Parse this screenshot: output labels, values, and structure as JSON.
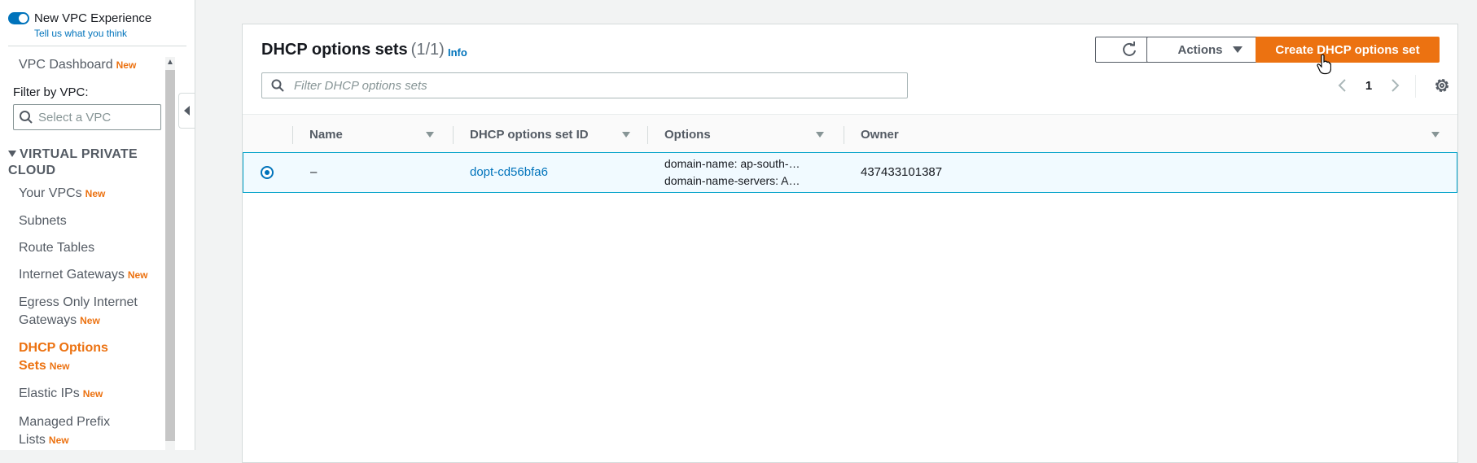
{
  "sidebar": {
    "toggle_label": "New VPC Experience",
    "feedback_link": "Tell us what you think",
    "dashboard_label": "VPC Dashboard",
    "new_badge": "New",
    "filter_label": "Filter by VPC:",
    "vpc_select_placeholder": "Select a VPC",
    "section_title": "VIRTUAL PRIVATE CLOUD",
    "items": [
      {
        "label": "Your VPCs",
        "badge": "New"
      },
      {
        "label": "Subnets",
        "badge": ""
      },
      {
        "label": "Route Tables",
        "badge": ""
      },
      {
        "label": "Internet Gateways",
        "badge": "New"
      },
      {
        "label": "Egress Only Internet Gateways",
        "badge": "New"
      },
      {
        "label": "DHCP Options Sets",
        "badge": "New"
      },
      {
        "label": "Elastic IPs",
        "badge": "New"
      },
      {
        "label": "Managed Prefix Lists",
        "badge": "New"
      }
    ]
  },
  "panel": {
    "title": "DHCP options sets",
    "count": "(1/1)",
    "info_link": "Info",
    "refresh_icon": "refresh-icon",
    "actions_label": "Actions",
    "create_label": "Create DHCP options set",
    "filter_placeholder": "Filter DHCP options sets",
    "page_number": "1"
  },
  "table": {
    "columns": [
      "Name",
      "DHCP options set ID",
      "Options",
      "Owner"
    ],
    "rows": [
      {
        "selected": true,
        "name": "–",
        "id": "dopt-cd56bfa6",
        "options_line1": "domain-name: ap-south-…",
        "options_line2": "domain-name-servers: A…",
        "owner": "437433101387"
      }
    ]
  },
  "colors": {
    "accent": "#ec7211",
    "link": "#0073bb",
    "selected_row_bg": "#f1faff",
    "selected_row_border": "#00a1c9"
  }
}
